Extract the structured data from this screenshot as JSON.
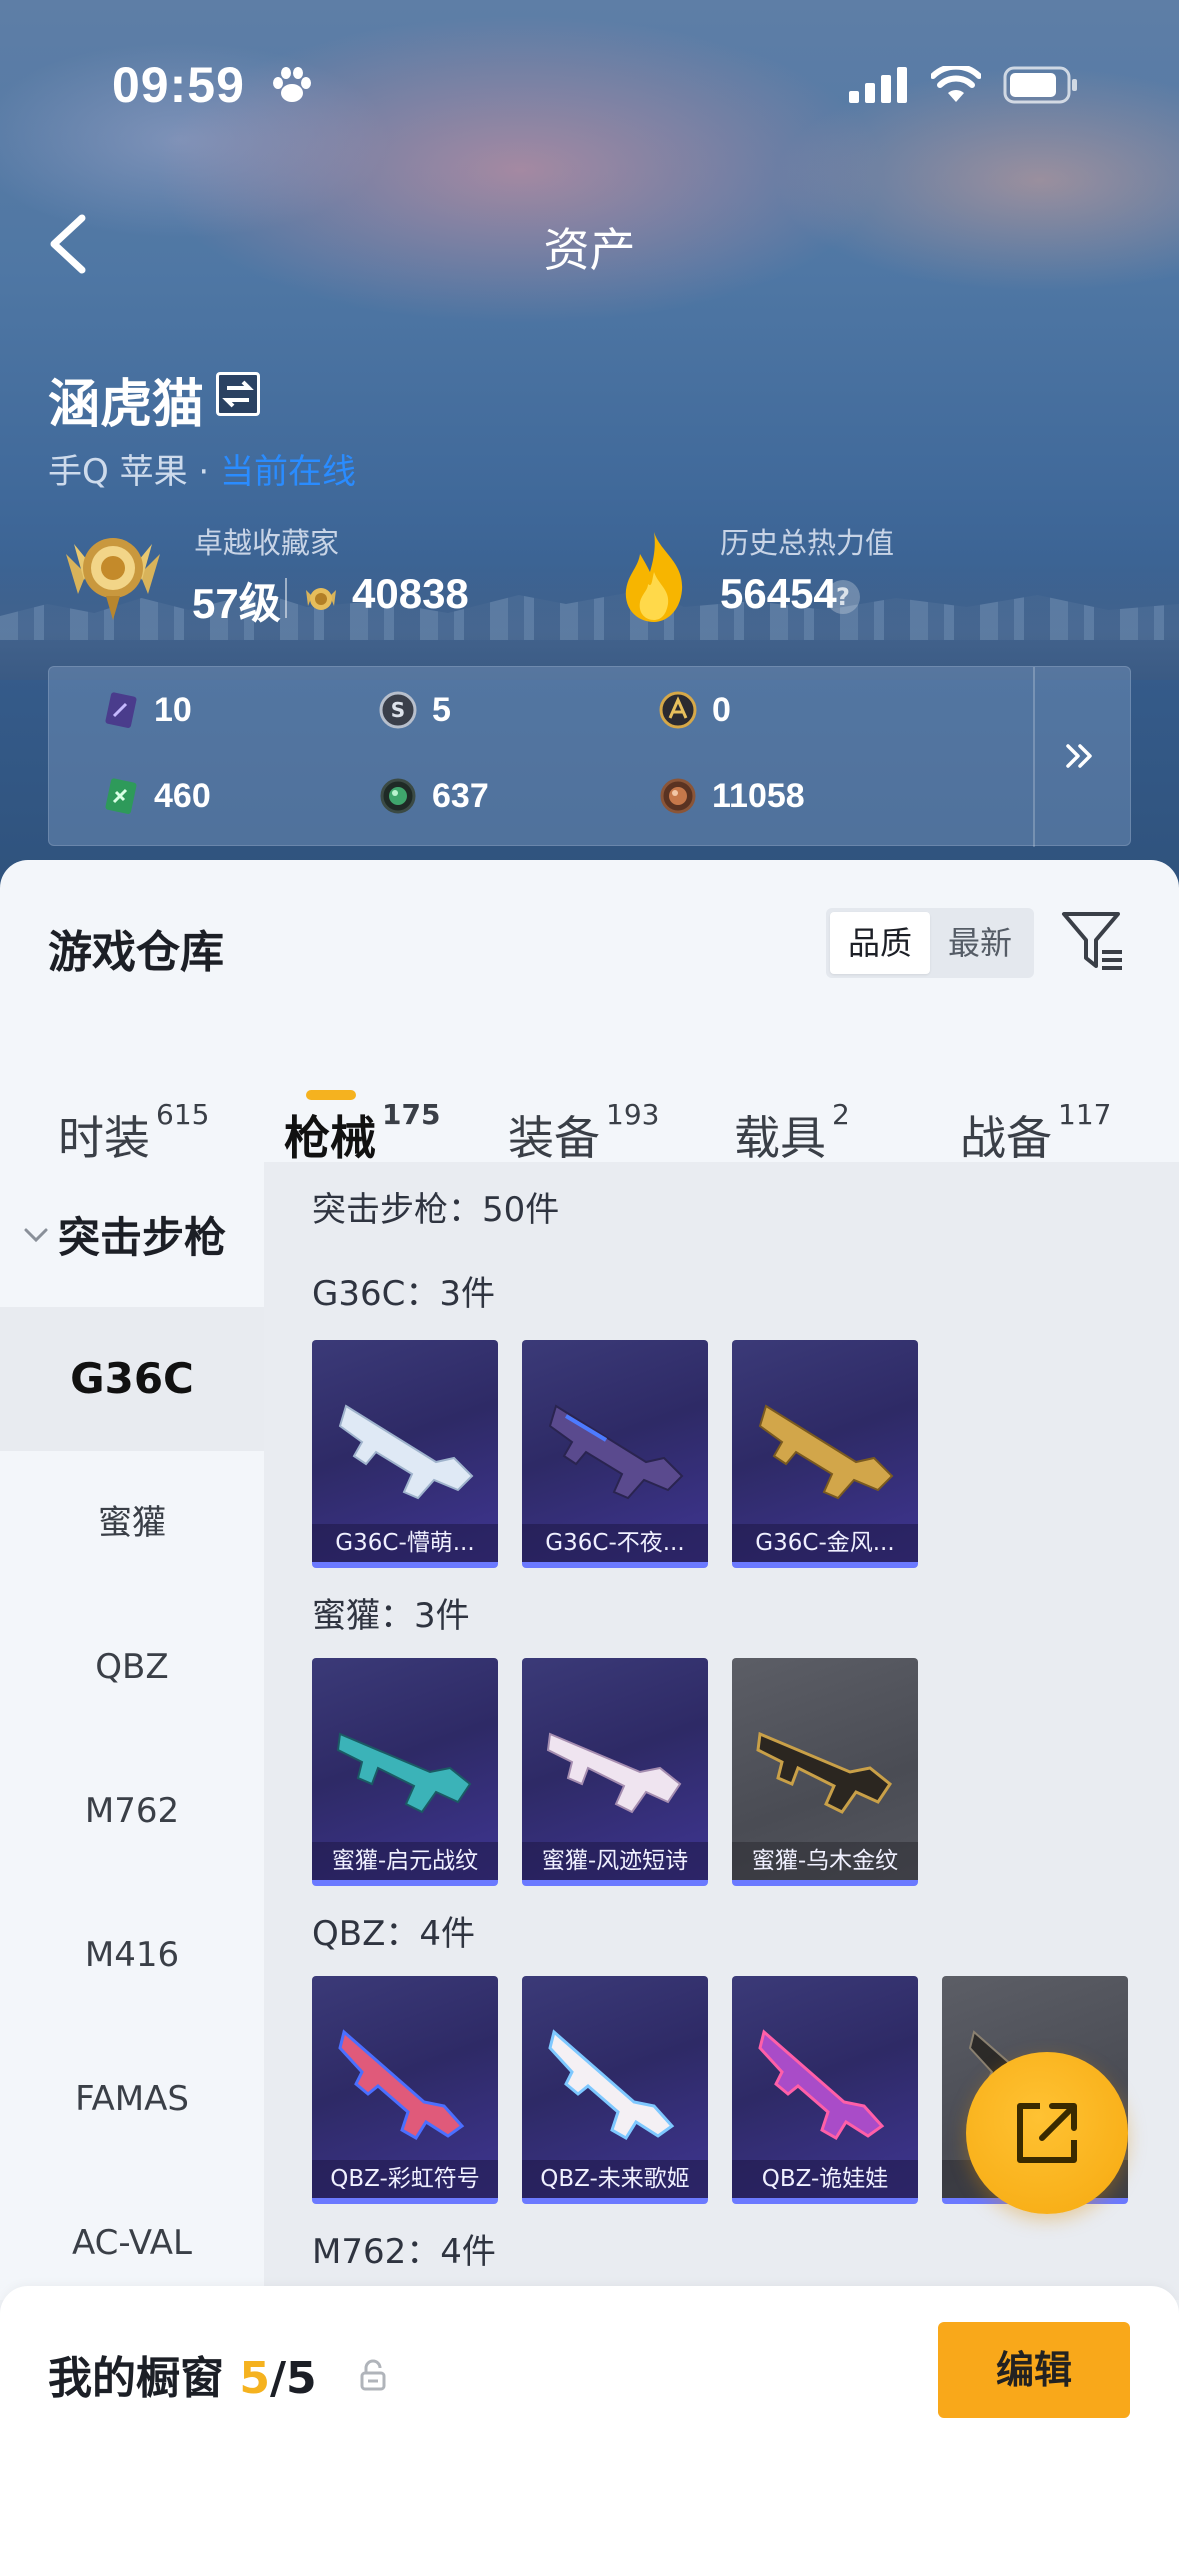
{
  "status_bar": {
    "time": "09:59"
  },
  "header": {
    "title": "资产"
  },
  "profile": {
    "username": "涵虎猫",
    "platform": "手Q 苹果 · ",
    "online_status": "当前在线",
    "collector_title": "卓越收藏家",
    "collector_level": "57级",
    "collector_points": "40838",
    "heat_label": "历史总热力值",
    "heat_value": "56454",
    "help": "?"
  },
  "resources": [
    {
      "icon": "purple-card-icon",
      "value": "10"
    },
    {
      "icon": "silver-token-icon",
      "value": "5"
    },
    {
      "icon": "gold-token-icon",
      "value": "0"
    },
    {
      "icon": "green-card-icon",
      "value": "460"
    },
    {
      "icon": "green-orb-icon",
      "value": "637"
    },
    {
      "icon": "bronze-orb-icon",
      "value": "11058"
    }
  ],
  "warehouse": {
    "title": "游戏仓库",
    "sort": {
      "quality": "品质",
      "latest": "最新"
    },
    "tabs": [
      {
        "label": "时装",
        "count": "615"
      },
      {
        "label": "枪械",
        "count": "175"
      },
      {
        "label": "装备",
        "count": "193"
      },
      {
        "label": "载具",
        "count": "2"
      },
      {
        "label": "战备",
        "count": "117"
      }
    ],
    "category_group": "突击步枪",
    "categories": [
      "G36C",
      "蜜獾",
      "QBZ",
      "M762",
      "M416",
      "FAMAS",
      "AC-VAL"
    ],
    "summary": "突击步枪：50件",
    "sections": [
      {
        "head": "G36C：3件",
        "items": [
          "G36C-懵萌...",
          "G36C-不夜...",
          "G36C-金风..."
        ]
      },
      {
        "head": "蜜獾：3件",
        "items": [
          "蜜獾-启元战纹",
          "蜜獾-风迹短诗",
          "蜜獾-乌木金纹"
        ]
      },
      {
        "head": "QBZ：4件",
        "items": [
          "QBZ-彩虹符号",
          "QBZ-未来歌姬",
          "QBZ-诡娃娃",
          "Q..."
        ]
      },
      {
        "head": "M762：4件"
      }
    ]
  },
  "showcase": {
    "label": "我的橱窗 ",
    "current": "5",
    "total": "/5",
    "edit": "编辑"
  },
  "colors": {
    "accent": "#f5b21f",
    "online": "#2a8cff",
    "card_border": "#6b79ff"
  }
}
